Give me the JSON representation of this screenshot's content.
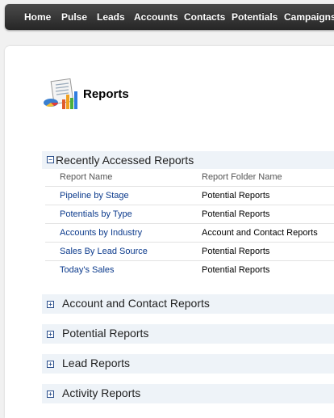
{
  "nav": {
    "items": [
      "Home",
      "Pulse",
      "Leads",
      "Accounts",
      "Contacts",
      "Potentials",
      "Campaigns"
    ]
  },
  "page": {
    "title": "Reports",
    "icon": "reports-chart-icon"
  },
  "recent": {
    "toggle": "−",
    "title": "Recently Accessed Reports",
    "col_name": "Report Name",
    "col_folder": "Report Folder Name",
    "rows": [
      {
        "name": "Pipeline by Stage",
        "folder": "Potential Reports"
      },
      {
        "name": "Potentials by Type",
        "folder": "Potential Reports"
      },
      {
        "name": "Accounts by Industry",
        "folder": "Account and Contact Reports"
      },
      {
        "name": "Sales By Lead Source",
        "folder": "Potential Reports"
      },
      {
        "name": "Today's Sales",
        "folder": "Potential Reports"
      }
    ]
  },
  "folders": [
    {
      "toggle": "+",
      "title": "Account and Contact Reports"
    },
    {
      "toggle": "+",
      "title": "Potential Reports"
    },
    {
      "toggle": "+",
      "title": "Lead Reports"
    },
    {
      "toggle": "+",
      "title": "Activity Reports"
    }
  ],
  "colors": {
    "link": "#0b3a8c",
    "section_bg": "#eef3f8",
    "nav_bg": "#333333"
  }
}
